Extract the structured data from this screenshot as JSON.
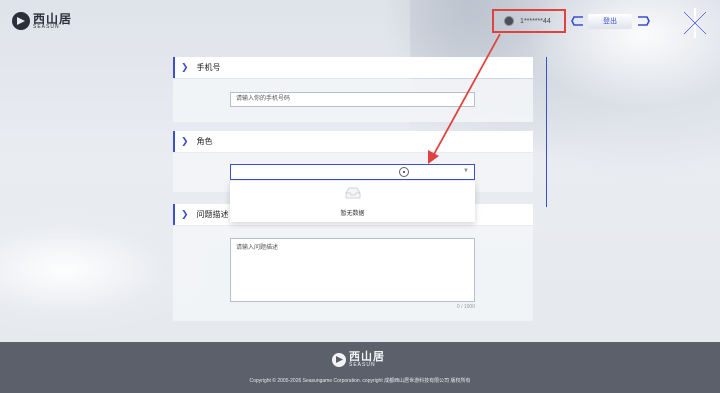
{
  "header": {
    "logo_cn": "西山居",
    "logo_en": "SEASUN",
    "user_name": "1*******44",
    "logout_label": "登出"
  },
  "form": {
    "phone": {
      "title": "手机号",
      "placeholder": "请输入你的手机号码"
    },
    "role": {
      "title": "角色",
      "empty_text": "暂无数据"
    },
    "description": {
      "title": "问题描述",
      "placeholder": "请输入问题描述",
      "counter": "0 / 1000"
    }
  },
  "footer": {
    "logo_cn": "西山居",
    "logo_en": "SEASUN",
    "copyright": "Copyright © 2005-2026 Seasungame Corporation. copyright    成都西山居世游科技有限公司 版权所有"
  },
  "colors": {
    "accent": "#3b4fd0",
    "annotation": "#e0433d",
    "footer_bg": "#5b606b"
  }
}
